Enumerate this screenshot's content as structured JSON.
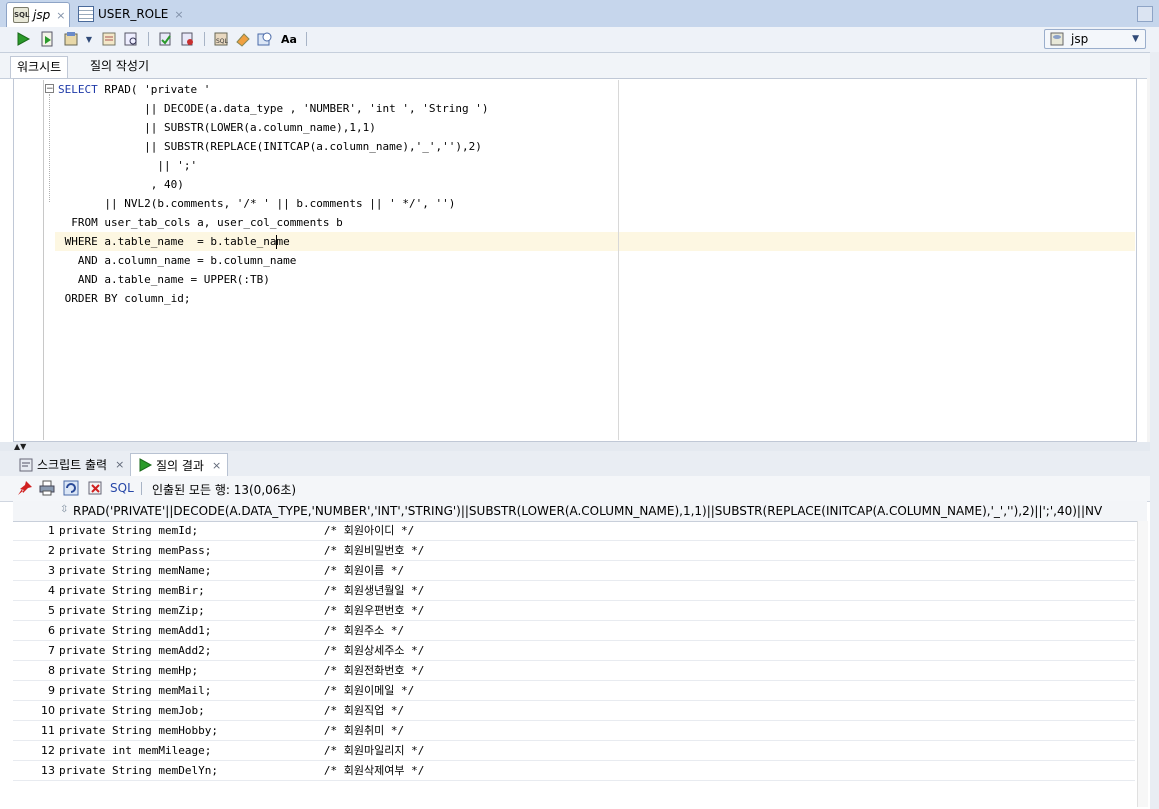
{
  "doc_tabs": [
    {
      "label": "jsp",
      "icon": "sql-worksheet-icon",
      "active": true
    },
    {
      "label": "USER_ROLE",
      "icon": "table-icon",
      "active": false
    }
  ],
  "close_glyph": "×",
  "connection": {
    "label": "jsp",
    "icon": "database-connection-icon"
  },
  "sub_tabs": [
    {
      "label": "워크시트",
      "active": true
    },
    {
      "label": "질의 작성기",
      "active": false
    }
  ],
  "code": [
    "SELECT RPAD( 'private '",
    "             || DECODE(a.data_type , 'NUMBER', 'int ', 'String ')",
    "             || SUBSTR(LOWER(a.column_name),1,1)",
    "             || SUBSTR(REPLACE(INITCAP(a.column_name),'_',''),2)",
    "               || ';'",
    "              , 40)",
    "       || NVL2(b.comments, '/* ' || b.comments || ' */', '')",
    "  FROM user_tab_cols a, user_col_comments b",
    " WHERE a.table_name  = b.table_name",
    "   AND a.column_name = b.column_name",
    "   AND a.table_name = UPPER(:TB)",
    " ORDER BY column_id;"
  ],
  "bottom_tabs": [
    {
      "label": "스크립트 출력",
      "active": false
    },
    {
      "label": "질의 결과",
      "active": true
    }
  ],
  "results": {
    "sql_label": "SQL",
    "status": "인출된 모든 행: 13(0,06초)",
    "column_header": "RPAD('PRIVATE'||DECODE(A.DATA_TYPE,'NUMBER','INT','STRING')||SUBSTR(LOWER(A.COLUMN_NAME),1,1)||SUBSTR(REPLACE(INITCAP(A.COLUMN_NAME),'_',''),2)||';',40)||NV",
    "rows": [
      {
        "num": "1",
        "value": "private String memId;                   /* 회원아이디 */"
      },
      {
        "num": "2",
        "value": "private String memPass;                 /* 회원비밀번호 */"
      },
      {
        "num": "3",
        "value": "private String memName;                 /* 회원이름 */"
      },
      {
        "num": "4",
        "value": "private String memBir;                  /* 회원생년월일 */"
      },
      {
        "num": "5",
        "value": "private String memZip;                  /* 회원우편번호 */"
      },
      {
        "num": "6",
        "value": "private String memAdd1;                 /* 회원주소 */"
      },
      {
        "num": "7",
        "value": "private String memAdd2;                 /* 회원상세주소 */"
      },
      {
        "num": "8",
        "value": "private String memHp;                   /* 회원전화번호 */"
      },
      {
        "num": "9",
        "value": "private String memMail;                 /* 회원이메일 */"
      },
      {
        "num": "10",
        "value": "private String memJob;                  /* 회원직업 */"
      },
      {
        "num": "11",
        "value": "private String memHobby;                /* 회원취미 */"
      },
      {
        "num": "12",
        "value": "private int memMileage;                 /* 회원마일리지 */"
      },
      {
        "num": "13",
        "value": "private String memDelYn;                /* 회원삭제여부 */"
      }
    ]
  },
  "colors": {
    "accent": "#2747a8",
    "keyword": "#1f3aa8",
    "highlight_line": "#fdf7e2"
  }
}
